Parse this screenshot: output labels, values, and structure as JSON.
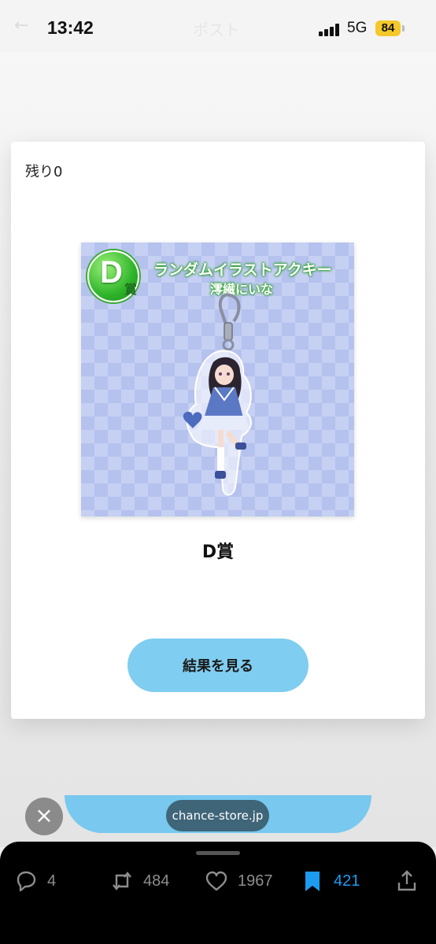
{
  "status_bar": {
    "time": "13:42",
    "network": "5G",
    "battery": "84",
    "faded_title": "ポスト"
  },
  "card": {
    "remaining": "残り0",
    "image": {
      "badge_letter": "D",
      "badge_suffix": "賞",
      "product_line1": "ランダムイラストアクキー",
      "product_line2": "澪繊にいな"
    },
    "prize_name": "D賞",
    "result_button": "結果を見る"
  },
  "browser": {
    "url": "chance-store.jp",
    "close_icon": "close-icon"
  },
  "post_actions": {
    "replies": "4",
    "reposts": "484",
    "likes": "1967",
    "bookmarks": "421"
  },
  "colors": {
    "accent_button": "#7fcdf0",
    "bookmark_active": "#1d9bf0",
    "bottom_bar": "#000000",
    "badge_green": "#2fb52a",
    "pattern_blue": "#c6d0f3"
  }
}
